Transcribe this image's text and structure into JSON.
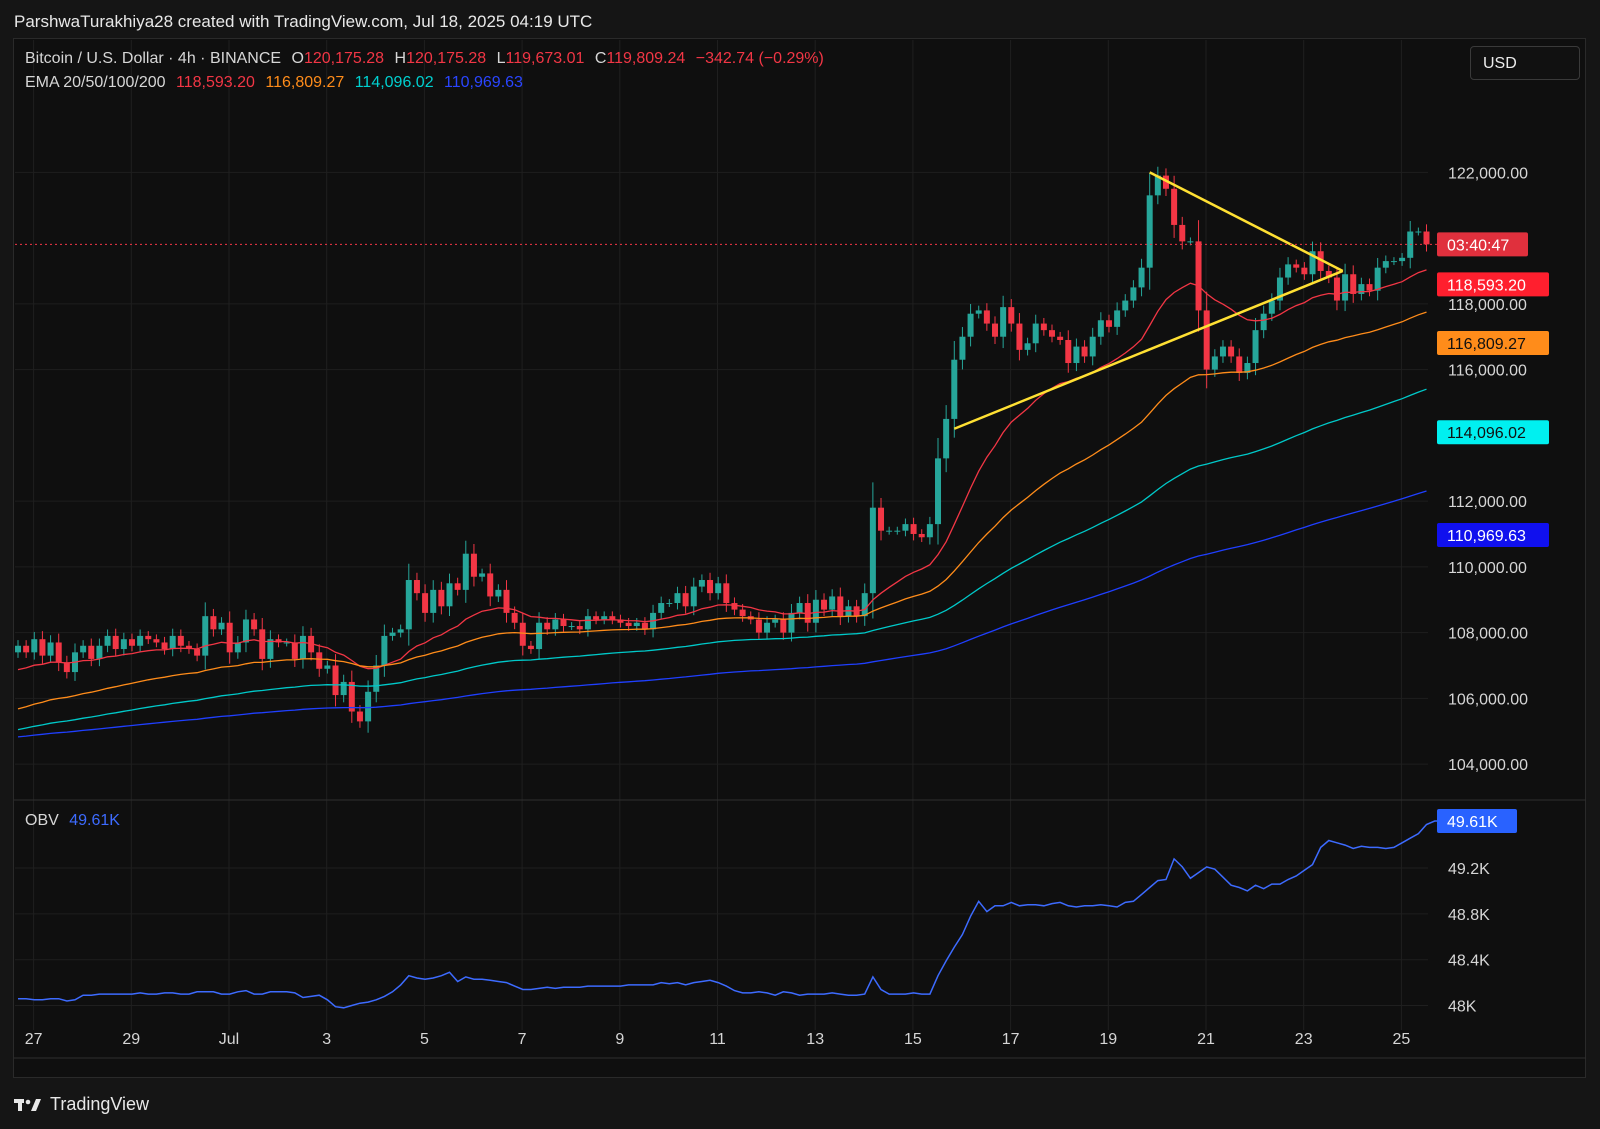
{
  "header": {
    "credit": "ParshwaTurakhiya28 created with TradingView.com, Jul 18, 2025 04:19 UTC"
  },
  "legend": {
    "symbol": "Bitcoin / U.S. Dollar · 4h · BINANCE",
    "o_label": "O",
    "o_value": "120,175.28",
    "h_label": "H",
    "h_value": "120,175.28",
    "l_label": "L",
    "l_value": "119,673.01",
    "c_label": "C",
    "c_value": "119,809.24",
    "change": "−342.74 (−0.29%)",
    "ema_label": "EMA 20/50/100/200",
    "ema20": "118,593.20",
    "ema50": "116,809.27",
    "ema100": "114,096.02",
    "ema200": "110,969.63"
  },
  "obv_legend": {
    "label": "OBV",
    "value": "49.61K"
  },
  "currency_button": "USD",
  "brand": "TradingView",
  "colors": {
    "up": "#26a69a",
    "down": "#f23645",
    "ema20": "#f23645",
    "ema50": "#ff8c1a",
    "ema100": "#00c9c9",
    "ema200": "#1f3fff",
    "obv": "#3d6bff",
    "triangle": "#ffe033"
  },
  "chart_data": [
    {
      "type": "candlestick",
      "title": "Bitcoin / U.S. Dollar · 4h · BINANCE",
      "x_tick_labels": [
        "27",
        "29",
        "Jul",
        "3",
        "5",
        "7",
        "9",
        "11",
        "13",
        "15",
        "17",
        "19",
        "21",
        "23",
        "25"
      ],
      "x_tick_days": [
        -4,
        -2,
        0,
        2,
        4,
        6,
        8,
        10,
        12,
        14,
        16,
        18,
        20,
        22,
        24
      ],
      "y_tick_labels": [
        "122,000.00",
        "118,000.00",
        "116,000.00",
        "112,000.00",
        "110,000.00",
        "108,000.00",
        "106,000.00",
        "104,000.00"
      ],
      "y_tick_values": [
        122000,
        118000,
        116000,
        112000,
        110000,
        108000,
        106000,
        104000
      ],
      "ylim": [
        103000,
        124200
      ],
      "closes": [
        107600,
        107400,
        107800,
        107300,
        107700,
        107100,
        106800,
        107400,
        107600,
        107200,
        107600,
        107900,
        107500,
        107800,
        107600,
        107900,
        107800,
        107700,
        107500,
        107900,
        107600,
        107500,
        107300,
        108500,
        108100,
        108300,
        107400,
        107700,
        108400,
        108100,
        107200,
        107800,
        107700,
        107700,
        107200,
        107900,
        107400,
        106900,
        107000,
        106100,
        106500,
        105600,
        105300,
        106200,
        107000,
        107900,
        108000,
        108100,
        109600,
        109200,
        108600,
        109300,
        108800,
        109500,
        109300,
        110400,
        109700,
        109800,
        109100,
        109300,
        108600,
        108300,
        107600,
        107500,
        108300,
        108100,
        108400,
        108200,
        108200,
        108100,
        108500,
        108400,
        108500,
        108400,
        108300,
        108200,
        108300,
        108100,
        108600,
        108900,
        108900,
        109200,
        108800,
        109400,
        109600,
        109200,
        109500,
        108900,
        108700,
        108500,
        108400,
        108000,
        108300,
        108400,
        108000,
        108600,
        108900,
        108300,
        109000,
        108700,
        109100,
        108500,
        108800,
        108500,
        109200,
        111800,
        111100,
        111100,
        111100,
        111300,
        111000,
        110900,
        111300,
        113300,
        114500,
        116300,
        117000,
        117700,
        117800,
        117400,
        117000,
        117900,
        117400,
        116600,
        116800,
        117400,
        117200,
        117000,
        116900,
        116200,
        116700,
        116400,
        117000,
        117500,
        117300,
        117800,
        118100,
        118500,
        119100,
        121300,
        121900,
        121500,
        120400,
        119900,
        119900,
        117800,
        116000,
        116400,
        116700,
        116400,
        115900,
        116200,
        117200,
        117700,
        118100,
        118800,
        119200,
        119100,
        118900,
        119600,
        119000,
        118800,
        118100,
        118900,
        118300,
        118600,
        118400,
        119100,
        119300,
        119300,
        119400,
        120200,
        120200,
        119809
      ]
    },
    {
      "type": "line",
      "title": "OBV",
      "y_tick_labels": [
        "49.2K",
        "48.8K",
        "48.4K",
        "48K"
      ],
      "y_tick_values": [
        49.2,
        48.8,
        48.4,
        48.0
      ],
      "ylim": [
        47.9,
        49.75
      ],
      "values": [
        48.06,
        48.06,
        48.05,
        48.05,
        48.06,
        48.06,
        48.04,
        48.05,
        48.09,
        48.09,
        48.1,
        48.1,
        48.1,
        48.1,
        48.1,
        48.11,
        48.1,
        48.1,
        48.11,
        48.11,
        48.1,
        48.1,
        48.12,
        48.12,
        48.12,
        48.1,
        48.1,
        48.12,
        48.13,
        48.1,
        48.1,
        48.12,
        48.12,
        48.12,
        48.11,
        48.07,
        48.08,
        48.09,
        48.05,
        47.99,
        47.98,
        48.0,
        48.02,
        48.03,
        48.05,
        48.08,
        48.12,
        48.18,
        48.26,
        48.24,
        48.23,
        48.24,
        48.26,
        48.29,
        48.21,
        48.25,
        48.23,
        48.23,
        48.22,
        48.21,
        48.2,
        48.17,
        48.14,
        48.14,
        48.15,
        48.16,
        48.15,
        48.16,
        48.16,
        48.16,
        48.17,
        48.17,
        48.17,
        48.17,
        48.17,
        48.18,
        48.18,
        48.18,
        48.18,
        48.2,
        48.19,
        48.2,
        48.18,
        48.2,
        48.21,
        48.22,
        48.2,
        48.17,
        48.13,
        48.11,
        48.11,
        48.12,
        48.11,
        48.09,
        48.12,
        48.11,
        48.09,
        48.1,
        48.1,
        48.1,
        48.11,
        48.1,
        48.09,
        48.09,
        48.1,
        48.25,
        48.14,
        48.1,
        48.1,
        48.1,
        48.11,
        48.1,
        48.1,
        48.26,
        48.39,
        48.51,
        48.62,
        48.78,
        48.91,
        48.82,
        48.87,
        48.87,
        48.9,
        48.87,
        48.88,
        48.88,
        48.87,
        48.89,
        48.9,
        48.87,
        48.86,
        48.87,
        48.87,
        48.88,
        48.87,
        48.86,
        48.9,
        48.91,
        48.97,
        49.03,
        49.09,
        49.1,
        49.28,
        49.21,
        49.11,
        49.16,
        49.21,
        49.19,
        49.12,
        49.05,
        49.03,
        49.0,
        49.05,
        49.02,
        49.06,
        49.06,
        49.1,
        49.13,
        49.18,
        49.23,
        49.38,
        49.44,
        49.42,
        49.4,
        49.37,
        49.39,
        49.38,
        49.38,
        49.37,
        49.38,
        49.42,
        49.46,
        49.5,
        49.58,
        49.61,
        49.61
      ]
    }
  ],
  "ema_labels": [
    {
      "name": "ema20",
      "text": "118,593.20",
      "value": 118593.2
    },
    {
      "name": "ema50",
      "text": "116,809.27",
      "value": 116809.27
    },
    {
      "name": "ema100",
      "text": "114,096.02",
      "value": 114096.02
    },
    {
      "name": "ema200",
      "text": "110,969.63",
      "value": 110969.63
    }
  ],
  "countdown": {
    "text": "03:40:47",
    "value": 119809.24
  },
  "obv_price_label": {
    "text": "49.61K",
    "value": 49.61
  }
}
